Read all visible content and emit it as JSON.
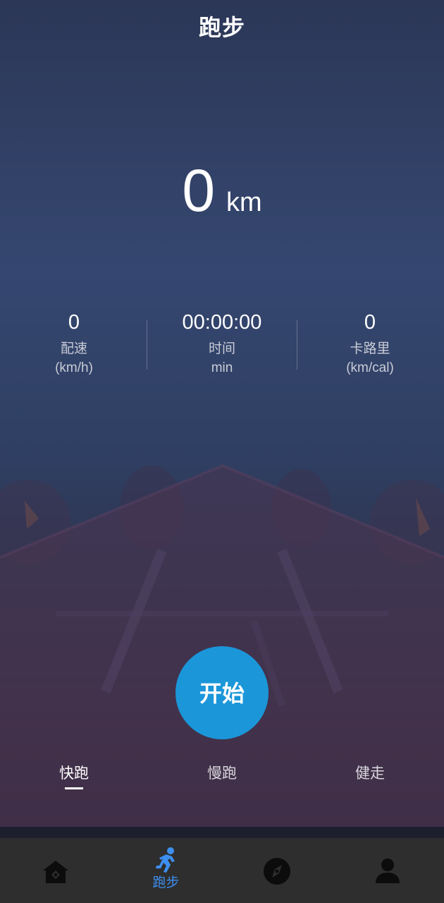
{
  "header": {
    "title": "跑步"
  },
  "distance": {
    "value": "0",
    "unit": "km"
  },
  "stats": [
    {
      "value": "0",
      "label": "配速",
      "unit": "(km/h)"
    },
    {
      "value": "00:00:00",
      "label": "时间",
      "unit": "min"
    },
    {
      "value": "0",
      "label": "卡路里",
      "unit": "(km/cal)"
    }
  ],
  "start_button": {
    "label": "开始"
  },
  "modes": [
    {
      "label": "快跑",
      "active": true
    },
    {
      "label": "慢跑",
      "active": false
    },
    {
      "label": "健走",
      "active": false
    }
  ],
  "tabbar": {
    "items": [
      {
        "icon": "home-icon",
        "label": ""
      },
      {
        "icon": "running-icon",
        "label": "跑步",
        "active": true
      },
      {
        "icon": "compass-icon",
        "label": ""
      },
      {
        "icon": "user-icon",
        "label": ""
      }
    ],
    "active_color": "#3d8ff0"
  },
  "colors": {
    "accent": "#1b96d9",
    "tabbar_bg": "#2e2e2e"
  }
}
